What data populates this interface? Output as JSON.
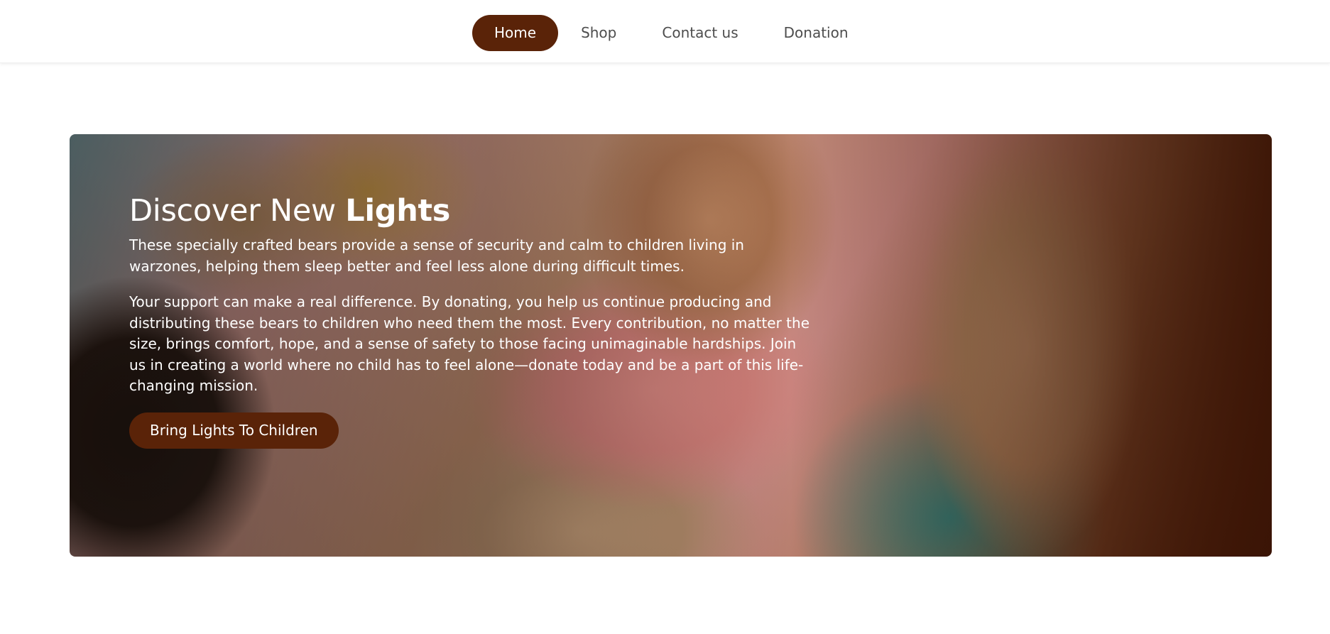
{
  "nav": {
    "items": [
      {
        "label": "Home",
        "active": true
      },
      {
        "label": "Shop",
        "active": false
      },
      {
        "label": "Contact us",
        "active": false
      },
      {
        "label": "Donation",
        "active": false
      }
    ]
  },
  "hero": {
    "title_regular": "Discover New ",
    "title_bold": "Lights",
    "paragraph1": "These specially crafted bears provide a sense of security and calm to children living in warzones, helping them sleep better and feel less alone during difficult times.",
    "paragraph2": "Your support can make a real difference. By donating, you help us continue producing and distributing these bears to children who need them the most. Every contribution, no matter the size, brings comfort, hope, and a sense of safety to those facing unimaginable hardships. Join us in creating a world where no child has to feel alone—donate today and be a part of this life-changing mission.",
    "cta_label": "Bring Lights To Children"
  },
  "colors": {
    "accent": "#5a2308",
    "nav_text": "#4d4d4d",
    "corner_badge": "#6e4a7e"
  },
  "icons": {
    "corner": "corner-bracket-icon"
  }
}
